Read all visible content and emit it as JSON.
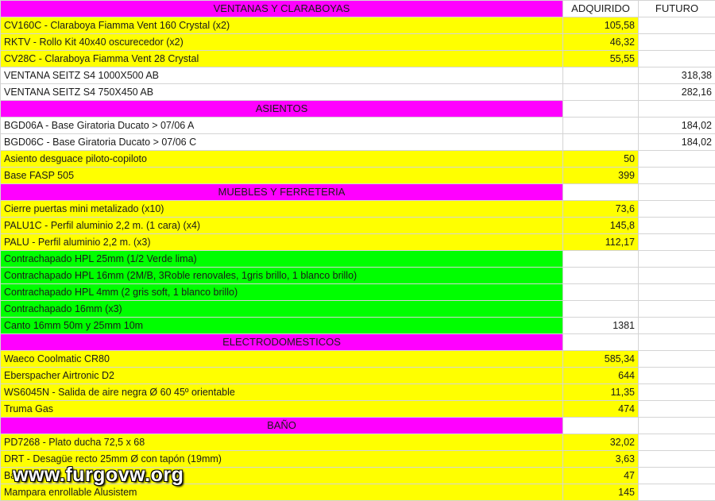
{
  "columns": {
    "adquirido": "ADQUIRIDO",
    "futuro": "FUTURO"
  },
  "rows": [
    {
      "type": "section",
      "label": "VENTANAS Y CLARABOYAS"
    },
    {
      "type": "item",
      "color": "yellow",
      "label": "CV160C - Claraboya Fiamma Vent 160 Crystal (x2)",
      "adquirido": "105,58",
      "futuro": ""
    },
    {
      "type": "item",
      "color": "yellow",
      "label": "RKTV - Rollo Kit 40x40 oscurecedor (x2)",
      "adquirido": "46,32",
      "futuro": ""
    },
    {
      "type": "item",
      "color": "yellow",
      "label": "CV28C - Claraboya Fiamma Vent 28 Crystal",
      "adquirido": "55,55",
      "futuro": ""
    },
    {
      "type": "item",
      "color": "white",
      "label": "VENTANA SEITZ S4 1000X500 AB",
      "adquirido": "",
      "futuro": "318,38"
    },
    {
      "type": "item",
      "color": "white",
      "label": "VENTANA SEITZ S4 750X450 AB",
      "adquirido": "",
      "futuro": "282,16"
    },
    {
      "type": "section",
      "label": "ASIENTOS"
    },
    {
      "type": "item",
      "color": "white",
      "label": "BGD06A - Base Giratoria Ducato > 07/06 A",
      "adquirido": "",
      "futuro": "184,02"
    },
    {
      "type": "item",
      "color": "white",
      "label": "BGD06C - Base Giratoria Ducato > 07/06 C",
      "adquirido": "",
      "futuro": "184,02"
    },
    {
      "type": "item",
      "color": "yellow",
      "label": "Asiento desguace piloto-copiloto",
      "adquirido": "50",
      "futuro": ""
    },
    {
      "type": "item",
      "color": "yellow",
      "label": "Base FASP 505",
      "adquirido": "399",
      "futuro": ""
    },
    {
      "type": "section",
      "label": "MUEBLES Y FERRETERIA"
    },
    {
      "type": "item",
      "color": "yellow",
      "label": "Cierre puertas mini metalizado (x10)",
      "adquirido": "73,6",
      "futuro": ""
    },
    {
      "type": "item",
      "color": "yellow",
      "label": "PALU1C - Perfil aluminio 2,2 m. (1 cara) (x4)",
      "adquirido": "145,8",
      "futuro": ""
    },
    {
      "type": "item",
      "color": "yellow",
      "label": "PALU - Perfil aluminio 2,2 m. (x3)",
      "adquirido": "112,17",
      "futuro": ""
    },
    {
      "type": "item",
      "color": "green",
      "label": "Contrachapado HPL 25mm (1/2 Verde lima)",
      "adquirido": "",
      "futuro": ""
    },
    {
      "type": "item",
      "color": "green",
      "label": "Contrachapado HPL 16mm (2M/B, 3Roble renovales, 1gris brillo, 1 blanco brillo)",
      "adquirido": "",
      "futuro": ""
    },
    {
      "type": "item",
      "color": "green",
      "label": "Contrachapado HPL 4mm (2 gris soft, 1 blanco brillo)",
      "adquirido": "",
      "futuro": ""
    },
    {
      "type": "item",
      "color": "green",
      "label": "Contrachapado 16mm (x3)",
      "adquirido": "",
      "futuro": ""
    },
    {
      "type": "item",
      "color": "green",
      "label": "Canto 16mm 50m y 25mm 10m",
      "adquirido": "1381",
      "futuro": ""
    },
    {
      "type": "section",
      "label": "ELECTRODOMESTICOS"
    },
    {
      "type": "item",
      "color": "yellow",
      "label": "Waeco Coolmatic CR80",
      "adquirido": "585,34",
      "futuro": ""
    },
    {
      "type": "item",
      "color": "yellow",
      "label": "Eberspacher Airtronic D2",
      "adquirido": "644",
      "futuro": ""
    },
    {
      "type": "item",
      "color": "yellow",
      "label": "WS6045N - Salida de aire negra Ø 60 45º orientable",
      "adquirido": "11,35",
      "futuro": ""
    },
    {
      "type": "item",
      "color": "yellow",
      "label": "Truma Gas",
      "adquirido": "474",
      "futuro": ""
    },
    {
      "type": "section",
      "label": "BAÑO"
    },
    {
      "type": "item",
      "color": "yellow",
      "label": "PD7268 - Plato ducha 72,5 x 68",
      "adquirido": "32,02",
      "futuro": ""
    },
    {
      "type": "item",
      "color": "yellow",
      "label": "DRT - Desagüe recto 25mm Ø con tapón (19mm)",
      "adquirido": "3,63",
      "futuro": ""
    },
    {
      "type": "item",
      "color": "yellow",
      "label": "Ba",
      "adquirido": "47",
      "futuro": ""
    },
    {
      "type": "item",
      "color": "yellow",
      "label": "Mampara enrollable Alusistem",
      "adquirido": "145",
      "futuro": ""
    }
  ],
  "watermark": "www.furgovw.org"
}
